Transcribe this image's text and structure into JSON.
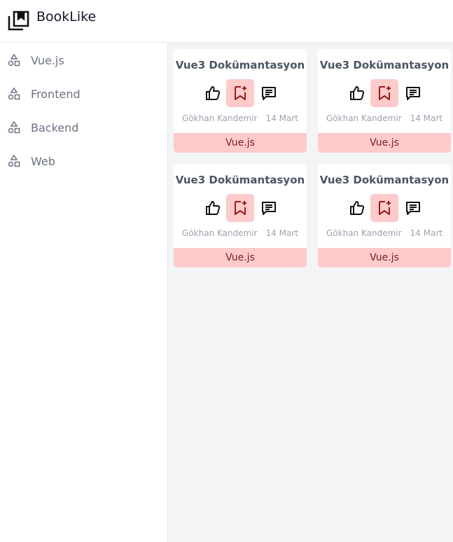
{
  "app": {
    "title": "BookLike",
    "logo_icon": "bookmarks-stack-icon"
  },
  "sidebar": {
    "items": [
      {
        "label": "Vue.js",
        "icon": "shapes-icon"
      },
      {
        "label": "Frontend",
        "icon": "shapes-icon"
      },
      {
        "label": "Backend",
        "icon": "shapes-icon"
      },
      {
        "label": "Web",
        "icon": "shapes-icon"
      }
    ]
  },
  "cards": [
    {
      "title": "Vue3 Dokümantasyon",
      "author": "Gökhan Kandemir",
      "date": "14 Mart",
      "category": "Vue.js"
    },
    {
      "title": "Vue3 Dokümantasyon",
      "author": "Gökhan Kandemir",
      "date": "14 Mart",
      "category": "Vue.js"
    },
    {
      "title": "Vue3 Dokümantasyon",
      "author": "Gökhan Kandemir",
      "date": "14 Mart",
      "category": "Vue.js"
    },
    {
      "title": "Vue3 Dokümantasyon",
      "author": "Gökhan Kandemir",
      "date": "14 Mart",
      "category": "Vue.js"
    }
  ],
  "card_actions": {
    "like_icon": "thumbs-up-icon",
    "bookmark_icon": "bookmark-add-icon",
    "comment_icon": "comment-icon"
  },
  "colors": {
    "tag_bg": "#fecaca",
    "tag_text": "#7f1d1d",
    "main_bg": "#f3f4f6"
  }
}
